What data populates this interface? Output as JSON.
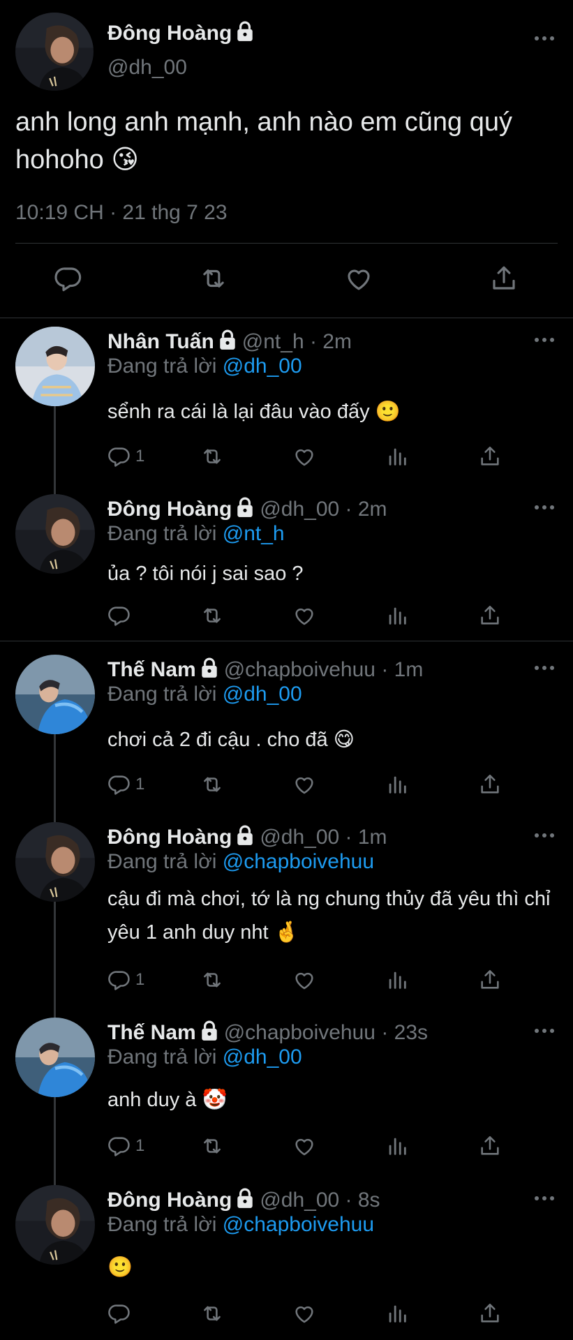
{
  "main": {
    "name": "Đông Hoàng",
    "handle": "@dh_00",
    "text": "anh long anh mạnh, anh nào em cũng quý hohoho 😘",
    "timestamp": "10:19 CH · 21 thg 7 23"
  },
  "replies": [
    {
      "name": "Nhân Tuấn",
      "handle": "@nt_h · 2m",
      "replying_prefix": "Đang trả lời ",
      "replying_to": "@dh_00",
      "text": "sểnh ra cái là lại đâu vào đấy 🙂",
      "reply_count": "1"
    },
    {
      "name": "Đông Hoàng",
      "handle": "@dh_00 · 2m",
      "replying_prefix": "Đang trả lời ",
      "replying_to": "@nt_h",
      "text": "ủa ? tôi nói j sai sao ?",
      "reply_count": ""
    },
    {
      "name": "Thế Nam",
      "handle": "@chapboivehuu · 1m",
      "replying_prefix": "Đang trả lời ",
      "replying_to": "@dh_00",
      "text": "chơi cả 2 đi cậu . cho đã 😋",
      "reply_count": "1"
    },
    {
      "name": "Đông Hoàng",
      "handle": "@dh_00 · 1m",
      "replying_prefix": "Đang trả lời ",
      "replying_to": "@chapboivehuu",
      "text": "cậu đi mà chơi, tớ là ng chung thủy đã yêu thì chỉ yêu 1 anh duy nht 🤞",
      "reply_count": "1"
    },
    {
      "name": "Thế Nam",
      "handle": "@chapboivehuu · 23s",
      "replying_prefix": "Đang trả lời ",
      "replying_to": "@dh_00",
      "text": "anh duy à 🤡",
      "reply_count": "1"
    },
    {
      "name": "Đông Hoàng",
      "handle": "@dh_00 · 8s",
      "replying_prefix": "Đang trả lời ",
      "replying_to": "@chapboivehuu",
      "text": "🙂",
      "reply_count": ""
    }
  ],
  "colors": {
    "background": "#000000",
    "text": "#e7e9ea",
    "muted": "#71767b",
    "link": "#1d9bf0",
    "divider": "#2f3336"
  }
}
